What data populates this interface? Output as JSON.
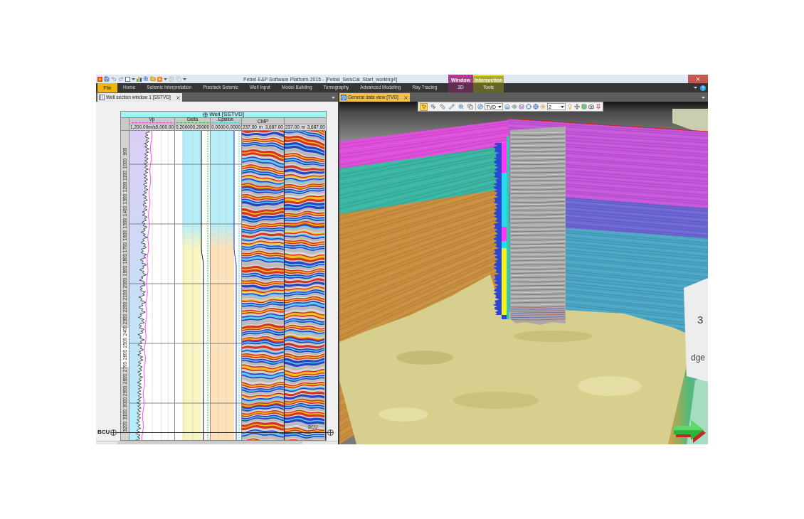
{
  "window": {
    "title": "Petrel E&P Software Platform 2015 - [Petrel_SeisCal_Start_working4]"
  },
  "ribbon": {
    "tabs": [
      {
        "label": "File",
        "kind": "file"
      },
      {
        "label": "Home",
        "kind": "tab"
      },
      {
        "label": "Seismic Interpretation",
        "kind": "tab"
      },
      {
        "label": "Prestack Seismic",
        "kind": "tab"
      },
      {
        "label": "Well Input",
        "kind": "tab"
      },
      {
        "label": "Model Building",
        "kind": "tab"
      },
      {
        "label": "Tomography",
        "kind": "tab"
      },
      {
        "label": "Advanced Modeling",
        "kind": "tab"
      },
      {
        "label": "Ray Tracing",
        "kind": "tab"
      }
    ],
    "contextual_groups": [
      {
        "label": "Window",
        "tab": "3D",
        "color": "#d42aa6"
      },
      {
        "label": "Intersection",
        "tab": "Tools",
        "color": "#e2e21e"
      }
    ]
  },
  "well_section_window": {
    "tab": {
      "title": "Well section window 1 [SSTVD]",
      "active": false
    },
    "header": {
      "title": "Well [SSTVD]"
    },
    "tracks": [
      {
        "name": "Vp",
        "kind": "curve",
        "color": "#ff2cff",
        "min": "1,200.00",
        "unit": "m/s",
        "max": "5,000.00"
      },
      {
        "name": "Delta",
        "kind": "zoned",
        "color": "#19c81e",
        "min": "0.20000",
        "max": "0.20000"
      },
      {
        "name": "Epsilon",
        "kind": "zoned",
        "color": "#14d2f0",
        "min": "0.0000",
        "max": "0.0000"
      }
    ],
    "seismic_tracks": [
      {
        "name": "CMP",
        "min": "237.00",
        "unit": "m",
        "max": "3,687.00"
      },
      {
        "min": "237.00",
        "unit": "m",
        "max": "3,687.00"
      }
    ],
    "depth_ticks": [
      "900",
      "1000",
      "1100",
      "1200",
      "1300",
      "1400",
      "1500",
      "1600",
      "1700",
      "1800",
      "1900",
      "2000",
      "2100",
      "2200",
      "2300",
      "2400",
      "2500",
      "2600",
      "2700",
      "2800",
      "2900",
      "3000",
      "3100",
      "3200"
    ],
    "marker": {
      "label": "BCU",
      "label_right": "BCU"
    }
  },
  "data_view_window": {
    "tab": {
      "title": "General data view [TVD]",
      "active": true
    },
    "toolbar": {
      "tools": [
        {
          "selected": true
        },
        {
          "selected": false
        },
        {
          "selected": false
        },
        {
          "selected": false
        },
        {
          "selected": false
        },
        {
          "selected": false
        }
      ],
      "dropdowns": [
        "TVD",
        "2"
      ]
    },
    "scene": {
      "label_fragments": [
        "3",
        "dge"
      ]
    }
  }
}
